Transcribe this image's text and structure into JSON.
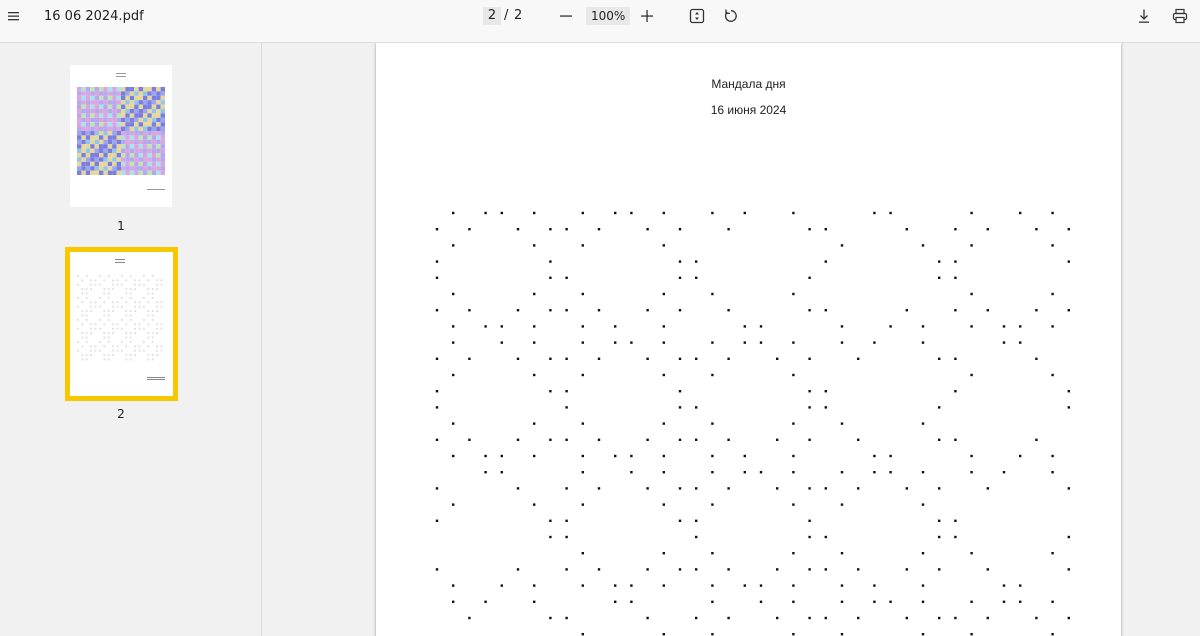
{
  "toolbar": {
    "menu_icon": "menu-icon",
    "file_name": "16 06 2024.pdf",
    "current_page": "2",
    "separator": "/",
    "total_pages": "2",
    "zoom": "100%",
    "icons": [
      "minus-icon",
      "plus-icon",
      "fit-page-icon",
      "rotate-icon",
      "download-icon",
      "print-icon"
    ]
  },
  "sidebar": {
    "thumbnails": [
      {
        "label": "1",
        "selected": false
      },
      {
        "label": "2",
        "selected": true
      }
    ],
    "selection_color": "#f7c700"
  },
  "page": {
    "title": "Мандала дня",
    "date": "16 июня 2024"
  }
}
